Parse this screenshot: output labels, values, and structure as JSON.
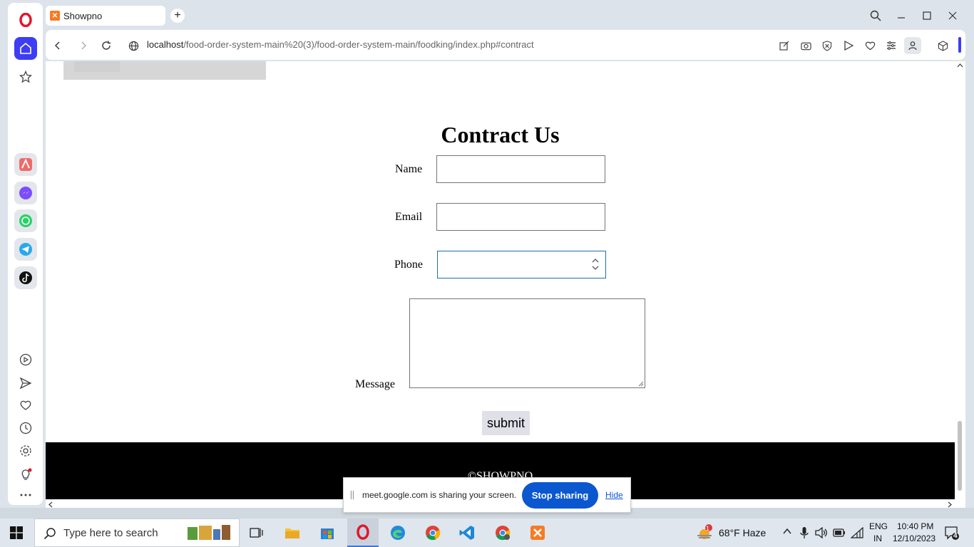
{
  "browser": {
    "tab_title": "Showpno",
    "url_host": "localhost",
    "url_path": "/food-order-system-main%20(3)/food-order-system-main/foodking/index.php#contract"
  },
  "page": {
    "title": "Contract Us",
    "form": {
      "name_label": "Name",
      "email_label": "Email",
      "phone_label": "Phone",
      "message_label": "Message",
      "name_value": "",
      "email_value": "",
      "phone_value": "",
      "message_value": "",
      "submit_label": "submit"
    },
    "footer_text": "©SHOWPNO"
  },
  "share_bar": {
    "message": "meet.google.com is sharing your screen.",
    "stop_label": "Stop sharing",
    "hide_label": "Hide"
  },
  "taskbar": {
    "search_placeholder": "Type here to search",
    "weather": "68°F  Haze",
    "weather_badge": "1",
    "lang_top": "ENG",
    "lang_bottom": "IN",
    "time": "10:40 PM",
    "date": "12/10/2023",
    "notification_count": "4"
  },
  "colors": {
    "share_button": "#0b57d0",
    "opera_red": "#e0182d",
    "sidebar_active": "#3d3df5"
  }
}
